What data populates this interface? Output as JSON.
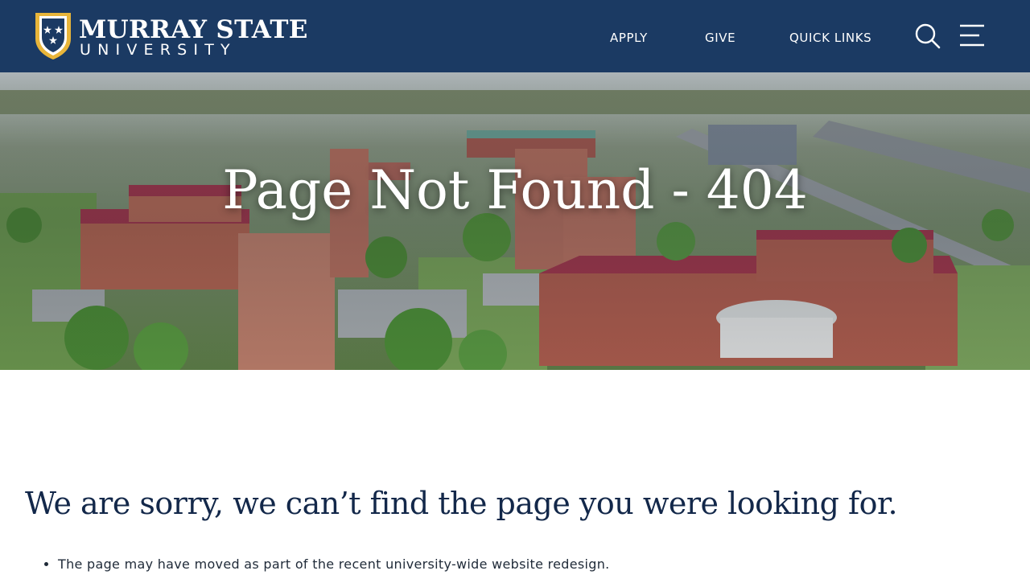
{
  "header": {
    "logo": {
      "line1": "MURRAY STATE",
      "line2": "UNIVERSITY"
    },
    "nav": [
      {
        "label": "APPLY"
      },
      {
        "label": "GIVE"
      },
      {
        "label": "QUICK LINKS"
      }
    ],
    "icons": {
      "search": "search-icon",
      "menu": "hamburger-menu-icon"
    }
  },
  "hero": {
    "title": "Page Not Found - 404"
  },
  "main": {
    "heading": "We are sorry, we can’t find the page you were looking for.",
    "reasons": [
      "The page may have moved as part of the recent university-wide website redesign."
    ]
  },
  "colors": {
    "header_bg": "#1b3a63",
    "gold": "#e8b53a",
    "heading_text": "#13284a",
    "brick_roof": "#a3374a"
  }
}
